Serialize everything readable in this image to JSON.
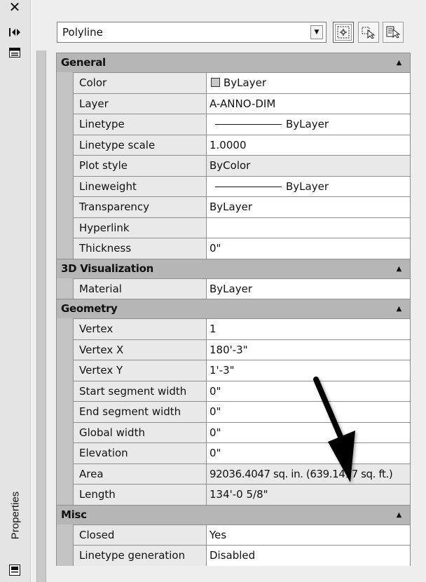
{
  "palette": {
    "title": "Properties",
    "selection": "Polyline"
  },
  "icons": {
    "close": "close-icon",
    "autohide": "autohide-icon",
    "settings": "settings-icon",
    "quick_select": "quick-select-icon",
    "select_objects": "select-objects-icon",
    "pickadd": "pickadd-icon"
  },
  "sections": {
    "general": {
      "title": "General",
      "rows": [
        {
          "name": "Color",
          "value": "ByLayer"
        },
        {
          "name": "Layer",
          "value": "A-ANNO-DIM"
        },
        {
          "name": "Linetype",
          "value": "ByLayer"
        },
        {
          "name": "Linetype scale",
          "value": "1.0000"
        },
        {
          "name": "Plot style",
          "value": "ByColor"
        },
        {
          "name": "Lineweight",
          "value": "ByLayer"
        },
        {
          "name": "Transparency",
          "value": "ByLayer"
        },
        {
          "name": "Hyperlink",
          "value": ""
        },
        {
          "name": "Thickness",
          "value": "0\""
        }
      ]
    },
    "viz": {
      "title": "3D Visualization",
      "rows": [
        {
          "name": "Material",
          "value": "ByLayer"
        }
      ]
    },
    "geometry": {
      "title": "Geometry",
      "rows": [
        {
          "name": "Vertex",
          "value": "1"
        },
        {
          "name": "Vertex X",
          "value": "180'-3\""
        },
        {
          "name": "Vertex Y",
          "value": "1'-3\""
        },
        {
          "name": "Start segment width",
          "value": "0\""
        },
        {
          "name": "End segment width",
          "value": "0\""
        },
        {
          "name": "Global width",
          "value": "0\""
        },
        {
          "name": "Elevation",
          "value": "0\""
        },
        {
          "name": "Area",
          "value": "92036.4047 sq. in. (639.1417 sq. ft.)"
        },
        {
          "name": "Length",
          "value": "134'-0 5/8\""
        }
      ]
    },
    "misc": {
      "title": "Misc",
      "rows": [
        {
          "name": "Closed",
          "value": "Yes"
        },
        {
          "name": "Linetype generation",
          "value": "Disabled"
        }
      ]
    }
  }
}
